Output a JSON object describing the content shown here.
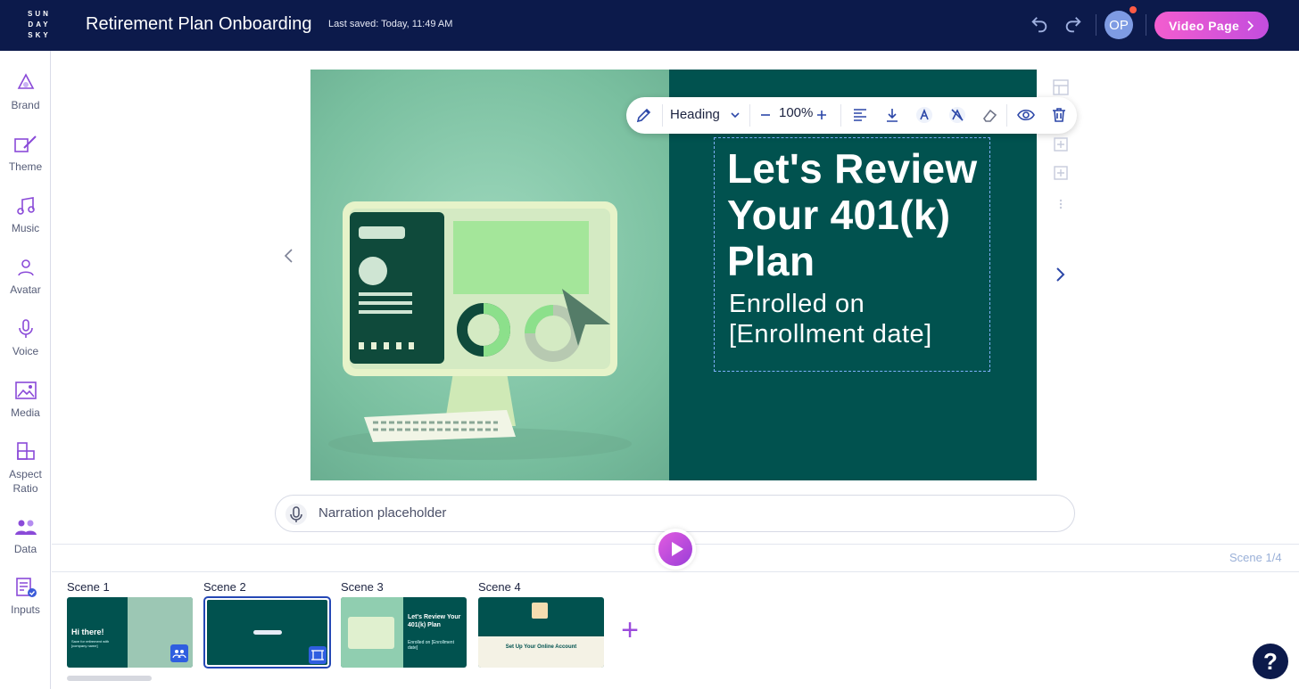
{
  "header": {
    "logo_lines": [
      "SUN",
      "DAY",
      "SKY"
    ],
    "title": "Retirement Plan Onboarding",
    "last_saved": "Last saved: Today, 11:49 AM",
    "avatar_initials": "OP",
    "video_page_label": "Video Page"
  },
  "sidebar": {
    "items": [
      {
        "label": "Brand",
        "icon": "palette-icon"
      },
      {
        "label": "Theme",
        "icon": "theme-icon"
      },
      {
        "label": "Music",
        "icon": "music-note-icon"
      },
      {
        "label": "Avatar",
        "icon": "person-icon"
      },
      {
        "label": "Voice",
        "icon": "microphone-icon"
      },
      {
        "label": "Media",
        "icon": "image-gallery-icon"
      },
      {
        "label": "Aspect Ratio",
        "icon": "aspect-ratio-icon"
      },
      {
        "label": "Data",
        "icon": "people-group-icon"
      },
      {
        "label": "Inputs",
        "icon": "checklist-icon"
      }
    ]
  },
  "stage": {
    "heading": "Let's Review Your 401(k) Plan",
    "subheading": "Enrolled on [Enrollment date]"
  },
  "text_toolbar": {
    "style": "Heading",
    "zoom": "100%"
  },
  "narration": {
    "placeholder": "Narration placeholder"
  },
  "timeline": {
    "scene_counter": "Scene 1/4",
    "scenes": [
      {
        "label": "Scene 1",
        "thumb_title": "Hi there!",
        "thumb_sub": "Save for retirement with [company name]"
      },
      {
        "label": "Scene 2",
        "thumb_title": "",
        "thumb_sub": ""
      },
      {
        "label": "Scene 3",
        "thumb_title": "Let's Review Your 401(k) Plan",
        "thumb_sub": "Enrolled on [Enrollment date]"
      },
      {
        "label": "Scene 4",
        "thumb_title": "Set Up Your Online Account",
        "thumb_sub": ""
      }
    ],
    "add_label": "+"
  },
  "help_label": "?",
  "colors": {
    "navy": "#0c1a4b",
    "teal": "#01524f",
    "mint": "#8fd0b1",
    "accent_purple": "#9b4bdc",
    "pink": "#f35dcf"
  }
}
